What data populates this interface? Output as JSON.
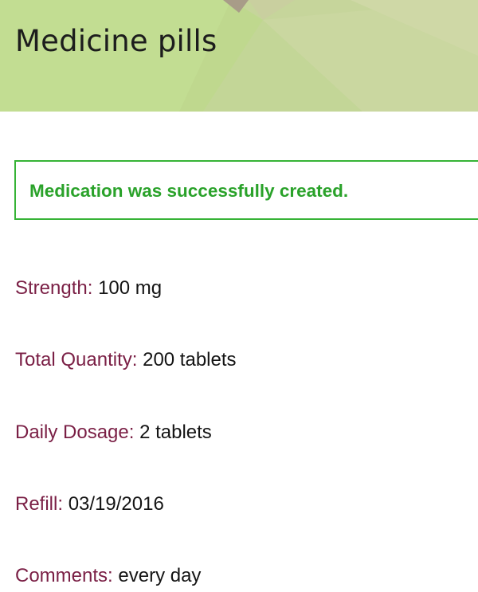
{
  "header": {
    "title": "Medicine pills"
  },
  "flash": {
    "message": "Medication was successfully created."
  },
  "details": {
    "strength": {
      "label": "Strength:",
      "value": "100 mg"
    },
    "total_quantity": {
      "label": "Total Quantity:",
      "value": "200 tablets"
    },
    "daily_dosage": {
      "label": "Daily Dosage:",
      "value": "2 tablets"
    },
    "refill": {
      "label": "Refill:",
      "value": "03/19/2016"
    },
    "comments": {
      "label": "Comments:",
      "value": "every day"
    }
  },
  "colors": {
    "header_green": "#c1dc93",
    "success_green": "#2aa22a",
    "label_maroon": "#7a1f45"
  }
}
